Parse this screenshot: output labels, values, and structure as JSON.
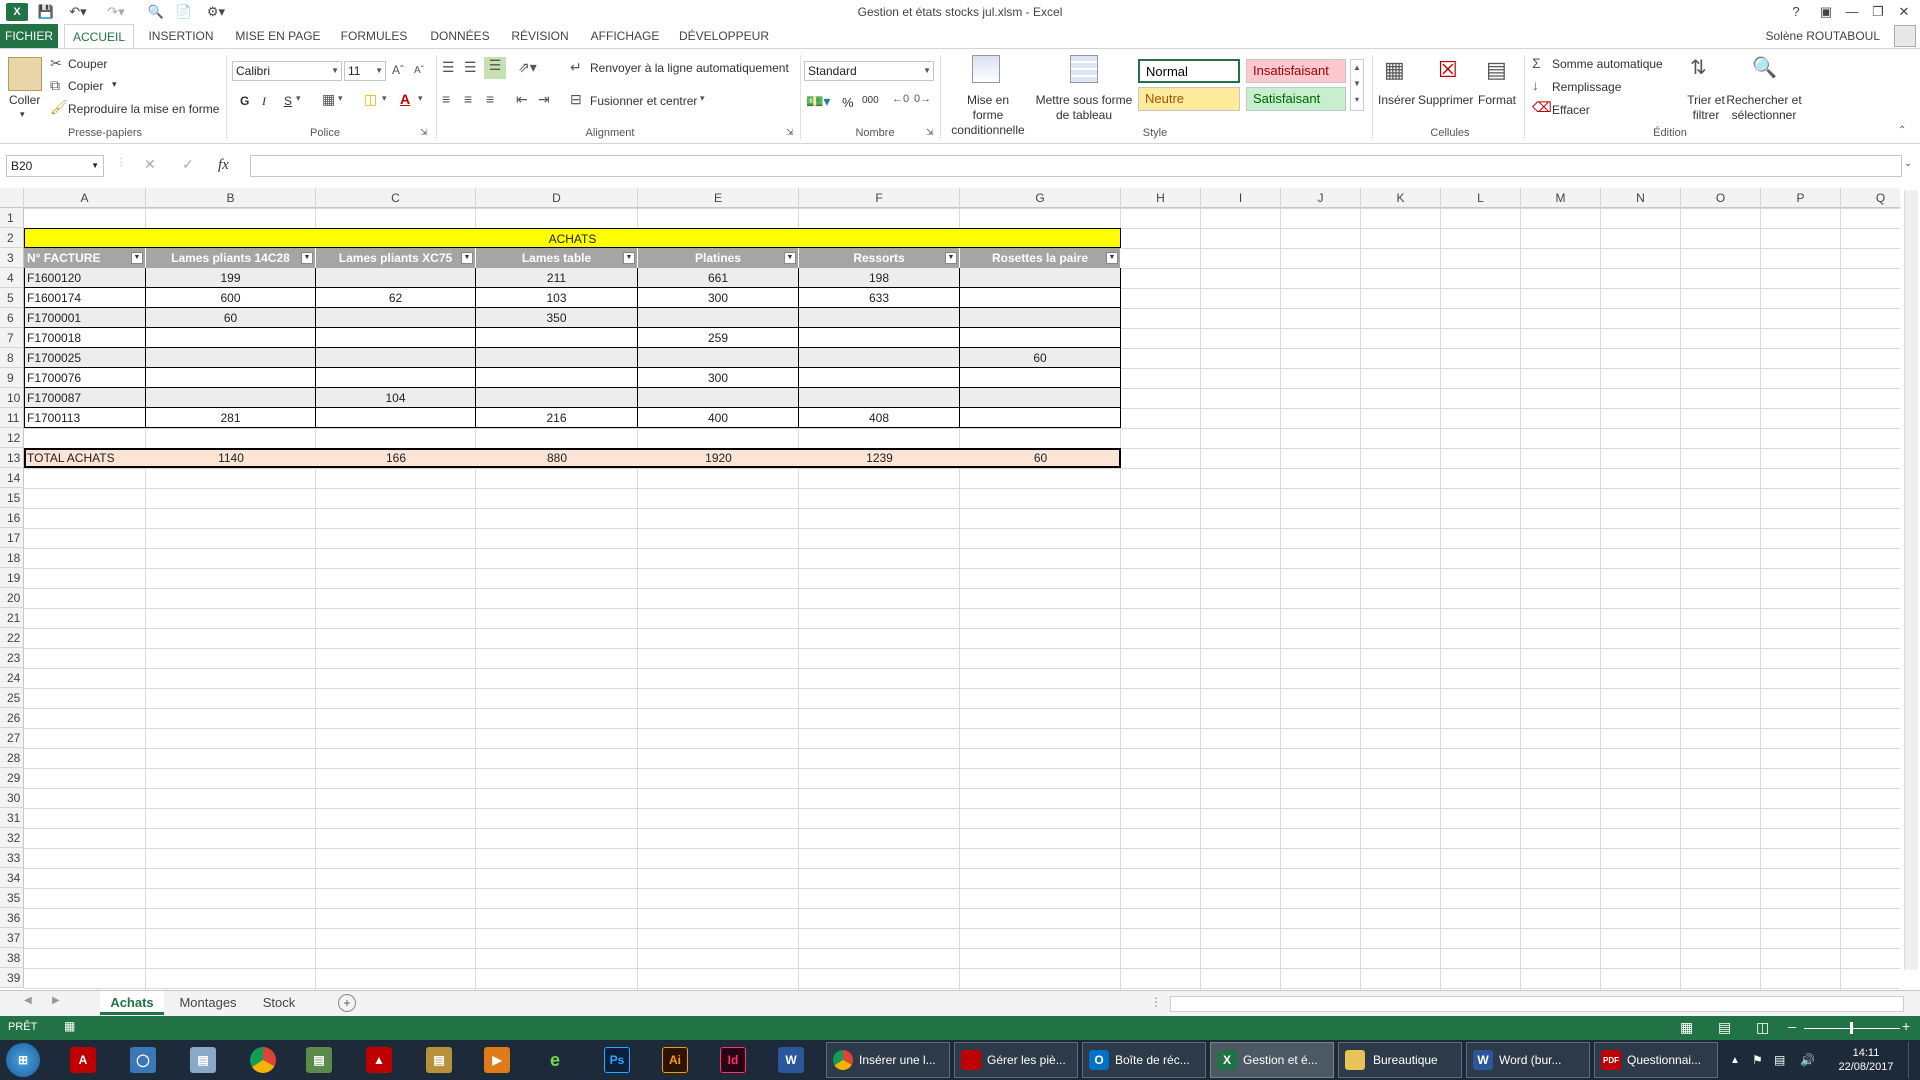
{
  "app": {
    "title": "Gestion et états stocks jul.xlsm - Excel",
    "user": "Solène ROUTABOUL",
    "help": "?"
  },
  "tabs": [
    "FICHIER",
    "ACCUEIL",
    "INSERTION",
    "MISE EN PAGE",
    "FORMULES",
    "DONNÉES",
    "RÉVISION",
    "AFFICHAGE",
    "DÉVELOPPEUR"
  ],
  "ribbon": {
    "clipboard": {
      "paste": "Coller",
      "cut": "Couper",
      "copy": "Copier",
      "format_painter": "Reproduire la mise en forme",
      "label": "Presse-papiers"
    },
    "font": {
      "name": "Calibri",
      "size": "11",
      "bold": "G",
      "italic": "I",
      "underline": "S",
      "label": "Police"
    },
    "alignment": {
      "wrap": "Renvoyer à la ligne automatiquement",
      "merge": "Fusionner et centrer",
      "label": "Alignment"
    },
    "number": {
      "format": "Standard",
      "percent": "%",
      "thousands": "000",
      "label": "Nombre"
    },
    "style": {
      "conditional": "Mise en forme conditionnelle",
      "as_table": "Mettre sous forme de tableau",
      "normal": "Normal",
      "bad": "Insatisfaisant",
      "neutral": "Neutre",
      "good": "Satisfaisant",
      "label": "Style"
    },
    "cells": {
      "insert": "Insérer",
      "delete": "Supprimer",
      "format": "Format",
      "label": "Cellules"
    },
    "editing": {
      "autosum": "Somme automatique",
      "fill": "Remplissage",
      "clear": "Effacer",
      "sort": "Trier et filtrer",
      "find": "Rechercher et sélectionner",
      "label": "Édition"
    }
  },
  "formula_bar": {
    "cell_ref": "B20",
    "fx": "fx",
    "value": ""
  },
  "columns": [
    "A",
    "B",
    "C",
    "D",
    "E",
    "F",
    "G",
    "H",
    "I",
    "J",
    "K",
    "L",
    "M",
    "N",
    "O",
    "P",
    "Q"
  ],
  "rows": [
    "1",
    "2",
    "3",
    "4",
    "5",
    "6",
    "7",
    "8",
    "9",
    "10",
    "11",
    "12",
    "13",
    "14",
    "15",
    "16",
    "17",
    "18",
    "19",
    "20",
    "21",
    "22",
    "23",
    "24",
    "25",
    "26",
    "27",
    "28",
    "29",
    "30",
    "31",
    "32",
    "33",
    "34",
    "35",
    "36",
    "37",
    "38",
    "39"
  ],
  "table": {
    "title": "ACHATS",
    "headers": [
      "N° FACTURE",
      "Lames pliants 14C28",
      "Lames pliants XC75",
      "Lames table",
      "Platines",
      "Ressorts",
      "Rosettes la paire"
    ],
    "rows": [
      [
        "F1600120",
        "199",
        "",
        "211",
        "661",
        "198",
        ""
      ],
      [
        "F1600174",
        "600",
        "62",
        "103",
        "300",
        "633",
        ""
      ],
      [
        "F1700001",
        "60",
        "",
        "350",
        "",
        "",
        ""
      ],
      [
        "F1700018",
        "",
        "",
        "",
        "259",
        "",
        ""
      ],
      [
        "F1700025",
        "",
        "",
        "",
        "",
        "",
        "60"
      ],
      [
        "F1700076",
        "",
        "",
        "",
        "300",
        "",
        ""
      ],
      [
        "F1700087",
        "",
        "104",
        "",
        "",
        "",
        ""
      ],
      [
        "F1700113",
        "281",
        "",
        "216",
        "400",
        "408",
        ""
      ]
    ],
    "total": [
      "TOTAL ACHATS",
      "1140",
      "166",
      "880",
      "1920",
      "1239",
      "60"
    ]
  },
  "sheet_tabs": [
    "Achats",
    "Montages",
    "Stock"
  ],
  "status": {
    "mode": "PRÊT"
  },
  "taskbar": {
    "buttons": [
      "Insérer une l...",
      "Gérer les piè...",
      "Boîte de réc...",
      "Gestion et é...",
      "Bureautique",
      "Word (bur...",
      "Questionnai..."
    ],
    "time": "14:11",
    "date": "22/08/2017"
  },
  "colors": {
    "excel_green": "#217346",
    "header_gray": "#a5a5a5",
    "title_yellow": "#ffff00",
    "total_fill": "#fce4d6",
    "band_gray": "#ededed"
  }
}
